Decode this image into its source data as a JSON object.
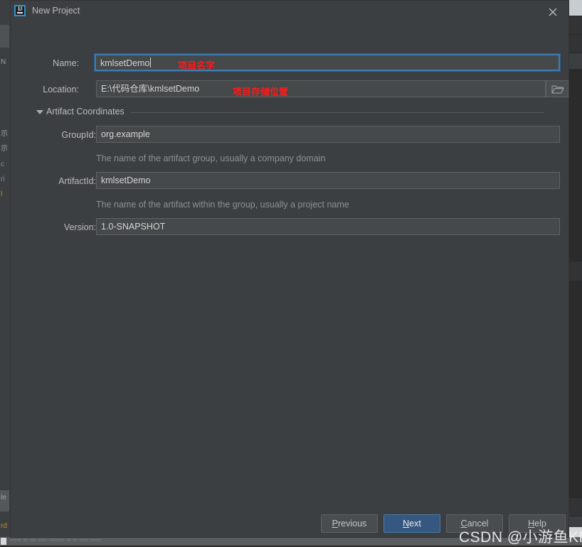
{
  "window": {
    "title": "New Project",
    "logo_icon": "intellij-idea-icon",
    "close_icon": "close-icon"
  },
  "form": {
    "name": {
      "label": "Name:",
      "value": "kmlsetDemo",
      "focused": true,
      "annotation": "项目名字"
    },
    "location": {
      "label": "Location:",
      "value": "E:\\代码仓库\\kmlsetDemo",
      "annotation": "项目存储位置",
      "browse_icon": "folder-icon"
    }
  },
  "section": {
    "title": "Artifact Coordinates",
    "expanded": true,
    "arrow_icon": "triangle-down-icon",
    "fields": [
      {
        "label": "GroupId:",
        "value": "org.example",
        "hint": "The name of the artifact group, usually a company domain"
      },
      {
        "label": "ArtifactId:",
        "value": "kmlsetDemo",
        "hint": "The name of the artifact within the group, usually a project name"
      },
      {
        "label": "Version:",
        "value": "1.0-SNAPSHOT",
        "hint": ""
      }
    ]
  },
  "footer": {
    "buttons": [
      {
        "label": "Previous",
        "mnemonic": "P",
        "primary": false
      },
      {
        "label": "Next",
        "mnemonic": "N",
        "primary": true
      },
      {
        "label": "Cancel",
        "mnemonic": "C",
        "primary": false
      },
      {
        "label": "Help",
        "mnemonic": "H",
        "primary": false
      }
    ]
  },
  "watermark": {
    "text": "CSDN @小游鱼KF"
  },
  "background": {
    "left_fragments": [
      "示",
      "示",
      "c",
      "ri",
      "l"
    ],
    "left_top_fragment": "N",
    "left_bottom_fragment": "le",
    "left_bottom_fragment2": "rd"
  },
  "colors": {
    "dialog_bg": "#3c3f41",
    "input_bg": "#45494a",
    "accent": "#365880",
    "focus_border": "#3f7cb3",
    "annotation_red": "#ff1a1a",
    "text": "#bbbbbb",
    "hint": "#8c9195"
  }
}
